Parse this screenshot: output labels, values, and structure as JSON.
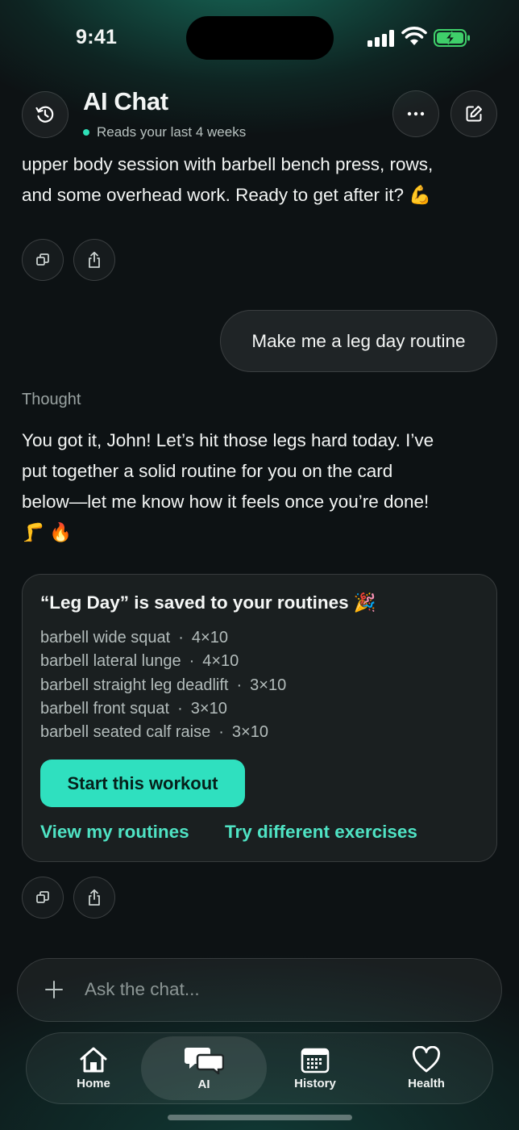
{
  "status_bar": {
    "time": "9:41"
  },
  "header": {
    "title": "AI Chat",
    "subtitle": "Reads your last 4 weeks"
  },
  "messages": {
    "ai_prev_line1": "upper body session with barbell bench press, rows,",
    "ai_prev_line2": "and some overhead work. Ready to get after it? 💪",
    "user_message": "Make me a leg day routine",
    "thought_label": "Thought",
    "ai_reply_line1": "You got it, John! Let’s hit those legs hard today. I’ve",
    "ai_reply_line2": "put together a solid routine for you on the card",
    "ai_reply_line3": "below—let me know how it feels once you’re done!",
    "ai_reply_line4": "🦵 🔥"
  },
  "routine_card": {
    "title": "“Leg Day” is saved to your routines 🎉",
    "separator": "·",
    "exercises": [
      {
        "name": "barbell wide squat",
        "sets": "4×10"
      },
      {
        "name": "barbell lateral lunge",
        "sets": "4×10"
      },
      {
        "name": "barbell straight leg deadlift",
        "sets": "3×10"
      },
      {
        "name": "barbell front squat",
        "sets": "3×10"
      },
      {
        "name": "barbell seated calf raise",
        "sets": "3×10"
      }
    ],
    "start_button": "Start this workout",
    "view_link": "View my routines",
    "try_link": "Try different exercises"
  },
  "composer": {
    "placeholder": "Ask the chat..."
  },
  "tabs": [
    {
      "label": "Home",
      "icon": "home-icon"
    },
    {
      "label": "AI",
      "icon": "chat-bubbles-icon"
    },
    {
      "label": "History",
      "icon": "calendar-icon"
    },
    {
      "label": "Health",
      "icon": "heart-icon"
    }
  ],
  "colors": {
    "accent": "#2fe0bf",
    "link": "#4fe3c4",
    "background": "#0d1214"
  }
}
